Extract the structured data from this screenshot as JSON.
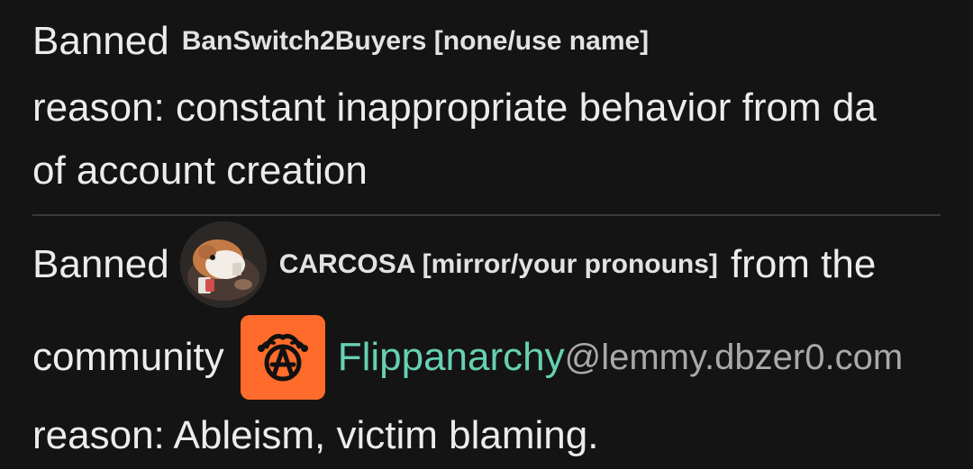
{
  "entry1": {
    "action": "Banned",
    "user": "BanSwitch2Buyers [none/use name]",
    "reason_line1": "reason: constant inappropriate behavior from da",
    "reason_line2": "of account creation"
  },
  "entry2": {
    "action": "Banned",
    "user": "CARCOSA [mirror/your pronouns]",
    "from_text": "from the",
    "community_label": "community",
    "community_name": "Flippanarchy",
    "community_instance": "@lemmy.dbzer0.com",
    "reason": "reason: Ableism, victim blaming."
  },
  "colors": {
    "background": "#141414",
    "community_link": "#67d0b2",
    "community_icon_bg": "#ff6b2a",
    "instance_text": "#a9a9a9"
  },
  "icons": {
    "user_avatar": "guinea-pig-avatar",
    "community_icon": "jester-anarchy-icon"
  }
}
